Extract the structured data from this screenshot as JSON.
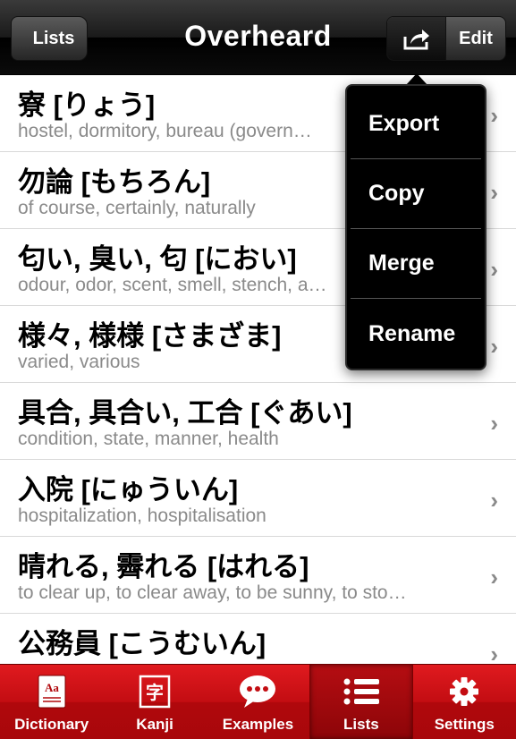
{
  "navbar": {
    "back_label": "Lists",
    "title": "Overheard",
    "edit_label": "Edit",
    "share_icon": "share-icon"
  },
  "popover": {
    "items": [
      {
        "label": "Export"
      },
      {
        "label": "Copy"
      },
      {
        "label": "Merge"
      },
      {
        "label": "Rename"
      }
    ]
  },
  "list": {
    "rows": [
      {
        "term": "寮 [りょう]",
        "gloss": "hostel, dormitory, bureau (govern…"
      },
      {
        "term": "勿論 [もちろん]",
        "gloss": "of course, certainly, naturally"
      },
      {
        "term": "匂い, 臭い, 匂 [におい]",
        "gloss": "odour, odor, scent, smell, stench, a…"
      },
      {
        "term": "様々, 様様 [さまざま]",
        "gloss": "varied, various"
      },
      {
        "term": "具合, 具合い, 工合 [ぐあい]",
        "gloss": "condition, state, manner, health"
      },
      {
        "term": "入院 [にゅういん]",
        "gloss": "hospitalization, hospitalisation"
      },
      {
        "term": "晴れる, 霽れる [はれる]",
        "gloss": "to clear up, to clear away, to be sunny, to sto…"
      },
      {
        "term": "公務員 [こうむいん]",
        "gloss": ""
      }
    ]
  },
  "tabbar": {
    "tabs": [
      {
        "label": "Dictionary",
        "icon": "dictionary-icon"
      },
      {
        "label": "Kanji",
        "icon": "kanji-icon"
      },
      {
        "label": "Examples",
        "icon": "speech-bubble-icon"
      },
      {
        "label": "Lists",
        "icon": "list-icon",
        "active": true
      },
      {
        "label": "Settings",
        "icon": "gear-icon"
      }
    ]
  },
  "colors": {
    "tabbar_red": "#c30d12",
    "navbar_black": "#0b0b0b",
    "gloss_gray": "#8a8a8a"
  }
}
